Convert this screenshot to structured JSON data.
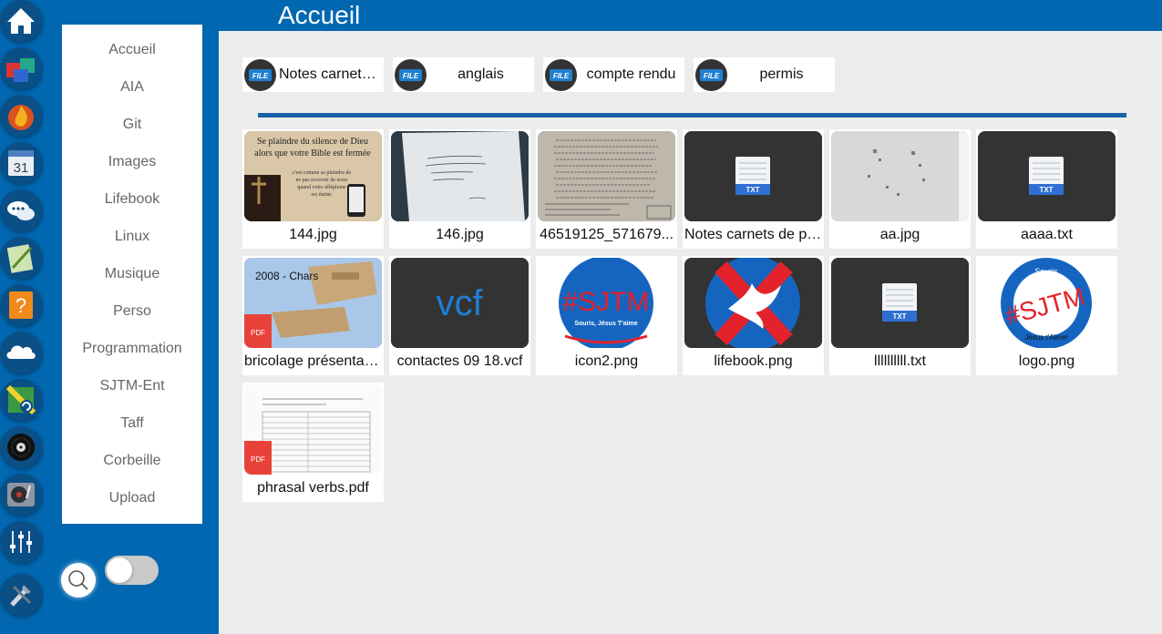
{
  "header": {
    "title": "Accueil"
  },
  "dock": {
    "apps": [
      {
        "name": "home-icon"
      },
      {
        "name": "cubes-icon"
      },
      {
        "name": "flame-icon"
      },
      {
        "name": "calendar-icon",
        "label": "31"
      },
      {
        "name": "chat-icon"
      },
      {
        "name": "notepad-icon"
      },
      {
        "name": "help-book-icon"
      },
      {
        "name": "cloud-icon"
      },
      {
        "name": "sync-icon"
      },
      {
        "name": "vinyl-icon"
      },
      {
        "name": "turntable-icon"
      },
      {
        "name": "sliders-icon"
      },
      {
        "name": "tools-icon"
      }
    ]
  },
  "menu": {
    "items": [
      {
        "label": "Accueil"
      },
      {
        "label": "AIA"
      },
      {
        "label": "Git"
      },
      {
        "label": "Images"
      },
      {
        "label": "Lifebook"
      },
      {
        "label": "Linux"
      },
      {
        "label": "Musique"
      },
      {
        "label": "Perso"
      },
      {
        "label": "Programmation"
      },
      {
        "label": "SJTM-Ent"
      },
      {
        "label": "Taff"
      },
      {
        "label": "Corbeille"
      },
      {
        "label": "Upload"
      }
    ]
  },
  "controls": {
    "toggle_on": false
  },
  "folders": {
    "badge": "FILE",
    "items": [
      {
        "label": "Notes carnets de poche"
      },
      {
        "label": "anglais"
      },
      {
        "label": "compte rendu"
      },
      {
        "label": "permis"
      }
    ]
  },
  "files": {
    "txt_badge": "TXT",
    "pdf_badge": "PDF",
    "items": [
      {
        "name": "144.jpg",
        "type": "image",
        "caption_1": "Se plaindre du silence de Dieu",
        "caption_2": "alors que votre Bible est fermée",
        "caption_3": "c'est comme se plaindre de",
        "caption_4": "ne pas recevoir de texto",
        "caption_5": "quand votre téléphone",
        "caption_6": "est éteint."
      },
      {
        "name": "146.jpg",
        "type": "image"
      },
      {
        "name": "46519125_571679...",
        "type": "image"
      },
      {
        "name": "Notes carnets de poche",
        "type": "txt"
      },
      {
        "name": "aa.jpg",
        "type": "image"
      },
      {
        "name": "aaaa.txt",
        "type": "txt"
      },
      {
        "name": "bricolage présentation.pdf",
        "type": "pdf",
        "caption": "2008 - Chars"
      },
      {
        "name": "contactes 09 18.vcf",
        "type": "vcf",
        "badge": "vcf"
      },
      {
        "name": "icon2.png",
        "type": "logo",
        "logo_text": "#SJTM",
        "logo_sub": "Souris, Jésus T'aime"
      },
      {
        "name": "lifebook.png",
        "type": "logo"
      },
      {
        "name": "llllllllll.txt",
        "type": "txt"
      },
      {
        "name": "logo.png",
        "type": "logo",
        "logo_text": "#SJTM",
        "logo_top": "Souris",
        "logo_sub": "Jésus t'Aime!"
      },
      {
        "name": "phrasal verbs.pdf",
        "type": "pdf"
      }
    ]
  },
  "colors": {
    "brand_blue": "#0167b0",
    "background": "#ececec",
    "sjtm_red": "#e3222b",
    "sjtm_blue": "#1565c0"
  }
}
